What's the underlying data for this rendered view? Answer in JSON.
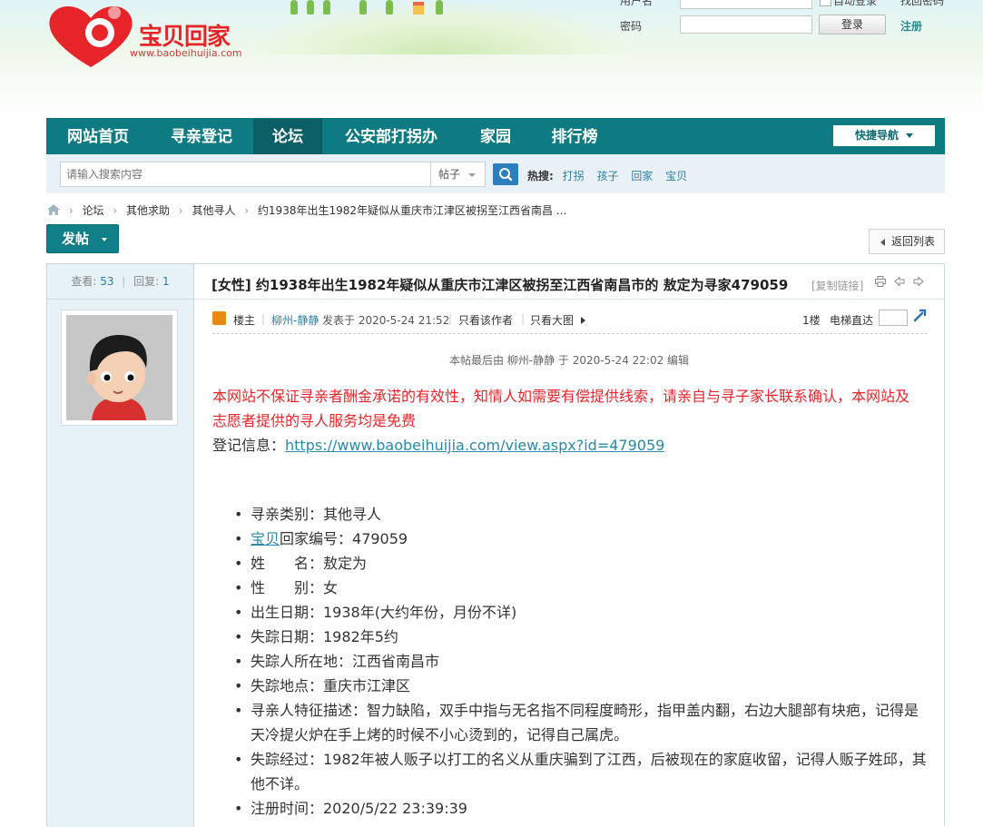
{
  "header": {
    "brand": "宝贝回家",
    "url": "www.baobeihuijia.com",
    "login": {
      "username_label": "用户名",
      "password_label": "密码",
      "auto_login": "自动登录",
      "forgot": "找回密码",
      "login_button": "登录",
      "register": "注册"
    }
  },
  "nav": {
    "items": [
      "网站首页",
      "寻亲登记",
      "论坛",
      "公安部打拐办",
      "家园",
      "排行榜"
    ],
    "active_index": 2,
    "quick_nav": "快捷导航"
  },
  "search": {
    "placeholder": "请输入搜索内容",
    "type": "帖子",
    "hot_label": "热搜:",
    "hot_words": [
      "打拐",
      "孩子",
      "回家",
      "宝贝"
    ]
  },
  "breadcrumb": [
    "论坛",
    "其他求助",
    "其他寻人",
    "约1938年出生1982年疑似从重庆市江津区被拐至江西省南昌 ..."
  ],
  "actions": {
    "post_button": "发帖",
    "back_button": "返回列表"
  },
  "thread": {
    "views_label": "查看:",
    "views": "53",
    "replies_label": "回复:",
    "replies": "1",
    "title": "[女性] 约1938年出生1982年疑似从重庆市江津区被拐至江西省南昌市的 敖定为寻家479059",
    "copy_link": "[复制链接]"
  },
  "post": {
    "owner_label": "楼主",
    "author": "柳州-静静",
    "posted": "发表于 2020-5-24 21:52",
    "only_author": "只看该作者",
    "only_images": "只看大图",
    "floor": "1楼",
    "floor_jump": "电梯直达",
    "edited": "本帖最后由 柳州-静静 于 2020-5-24 22:02 编辑",
    "notice": "本网站不保证寻亲者酬金承诺的有效性，知情人如需要有偿提供线索，请亲自与寻子家长联系确认，本网站及志愿者提供的寻人服务均是免费",
    "reg_label": "登记信息：",
    "reg_link": "https://www.baobeihuijia.com/view.aspx?id=479059",
    "fields": [
      "寻亲类别：其他寻人",
      "回家编号：479059",
      "姓　　名：敖定为",
      "性　　别：女",
      "出生日期：1938年(大约年份，月份不详)",
      "失踪日期：1982年5约",
      "失踪人所在地：江西省南昌市",
      "失踪地点：重庆市江津区",
      "寻亲人特征描述：智力缺陷，双手中指与无名指不同程度畸形，指甲盖内翻，右边大腿部有块疤，记得是天冷提火炉在手上烤的时候不小心烫到的，记得自己属虎。",
      "失踪经过：1982年被人贩子以打工的名义从重庆骗到了江西，后被现在的家庭收留，记得人贩子姓邱，其他不详。",
      "注册时间：2020/5/22 23:39:39"
    ],
    "field_link_word": "宝贝"
  },
  "colors": {
    "nav_bg": "#0e7a82",
    "brand_red": "#e8242b",
    "link": "#2a8aa8",
    "notice_red": "#e8262b"
  }
}
